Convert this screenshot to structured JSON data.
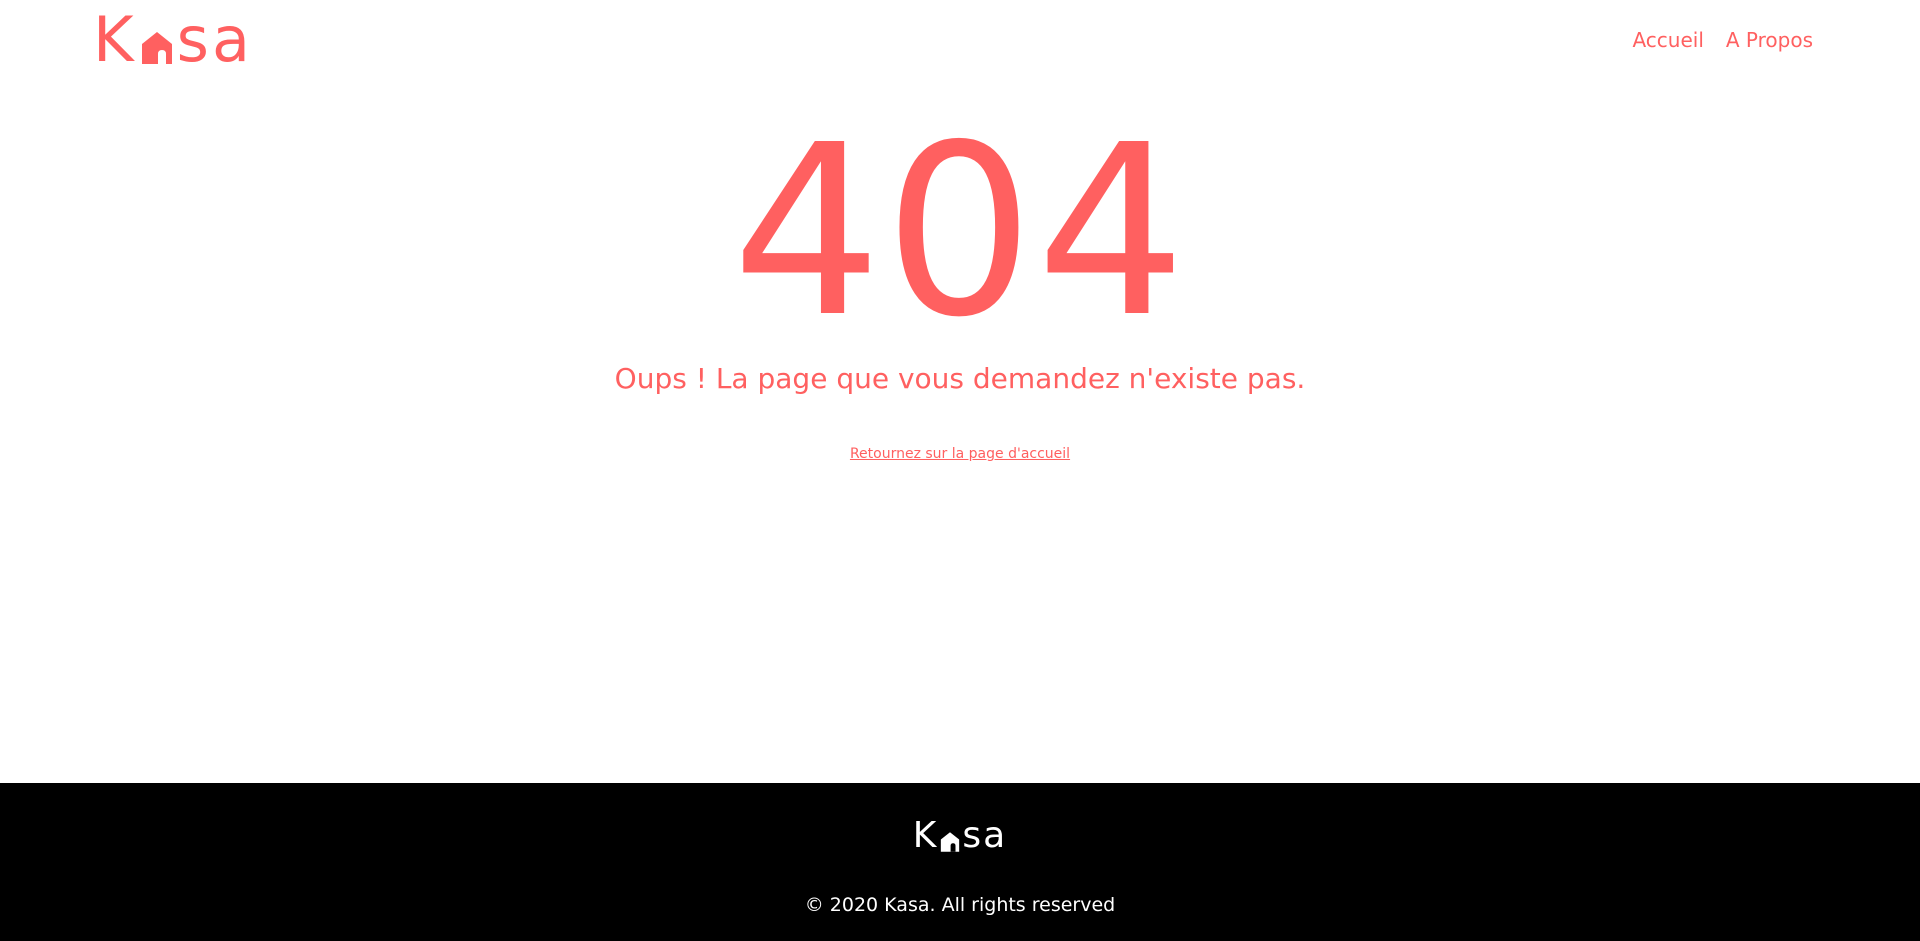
{
  "brand": {
    "name_prefix": "K",
    "name_suffix": "sa",
    "logo_icon": "house-icon",
    "accent_color": "#FF6060"
  },
  "nav": {
    "items": [
      {
        "label": "Accueil"
      },
      {
        "label": "A Propos"
      }
    ]
  },
  "error": {
    "code": "404",
    "message": "Oups ! La page que vous demandez n'existe pas.",
    "back_link": "Retournez sur la page d'accueil"
  },
  "footer": {
    "logo_prefix": "K",
    "logo_suffix": "sa",
    "copyright": "© 2020 Kasa. All rights reserved",
    "background": "#000000"
  }
}
